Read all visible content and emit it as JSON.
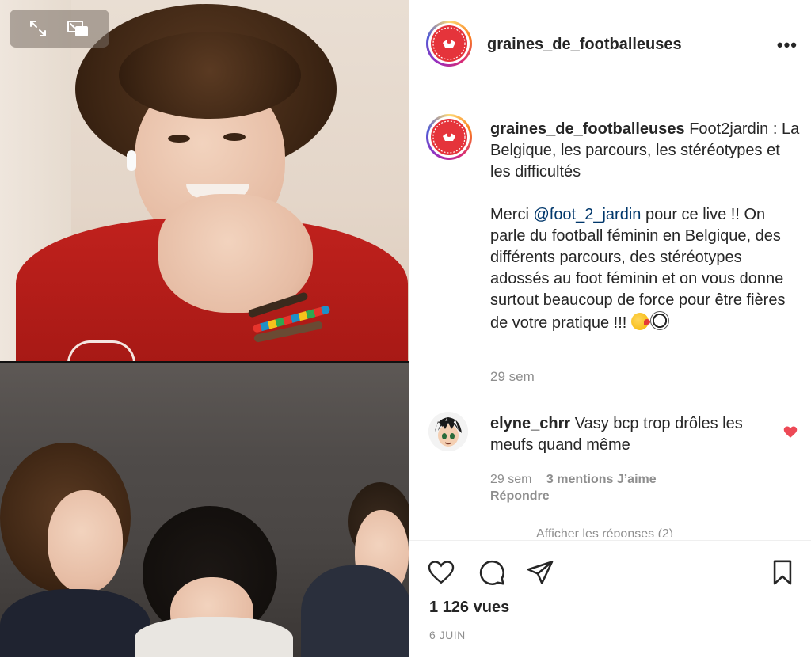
{
  "video": {
    "controls": [
      {
        "name": "expand-icon"
      },
      {
        "name": "picture-in-picture-icon"
      }
    ]
  },
  "post": {
    "username": "graines_de_footballeuses",
    "more_label": "•••",
    "caption": {
      "username": "graines_de_footballeuses",
      "title": "Foot2jardin : La Belgique, les parcours, les stéréotypes et les difficultés",
      "body_before_mention": "Merci ",
      "mention": "@foot_2_jardin",
      "body_after_mention": " pour ce live !! On parle du football féminin en Belgique, des différents parcours, des stéréotypes adossés au foot féminin et on vous donne surtout beaucoup de force pour être fières de votre pratique !!! ",
      "emojis": [
        "kissing-face-emoji",
        "soccer-ball-emoji"
      ]
    },
    "time": "29 sem"
  },
  "comment": {
    "username": "elyne_chrr",
    "text": "Vasy bcp trop drôles les meufs quand même",
    "time": "29 sem",
    "likes": "3 mentions J’aime",
    "reply": "Répondre",
    "view_replies": "Afficher les réponses (2)",
    "liked": true
  },
  "actions": {
    "views": "1 126 vues",
    "date": "6 JUIN"
  },
  "colors": {
    "brand_red": "#e5343b",
    "like_red": "#ed4956",
    "mention_blue": "#00376b",
    "muted": "#8e8e8e"
  }
}
